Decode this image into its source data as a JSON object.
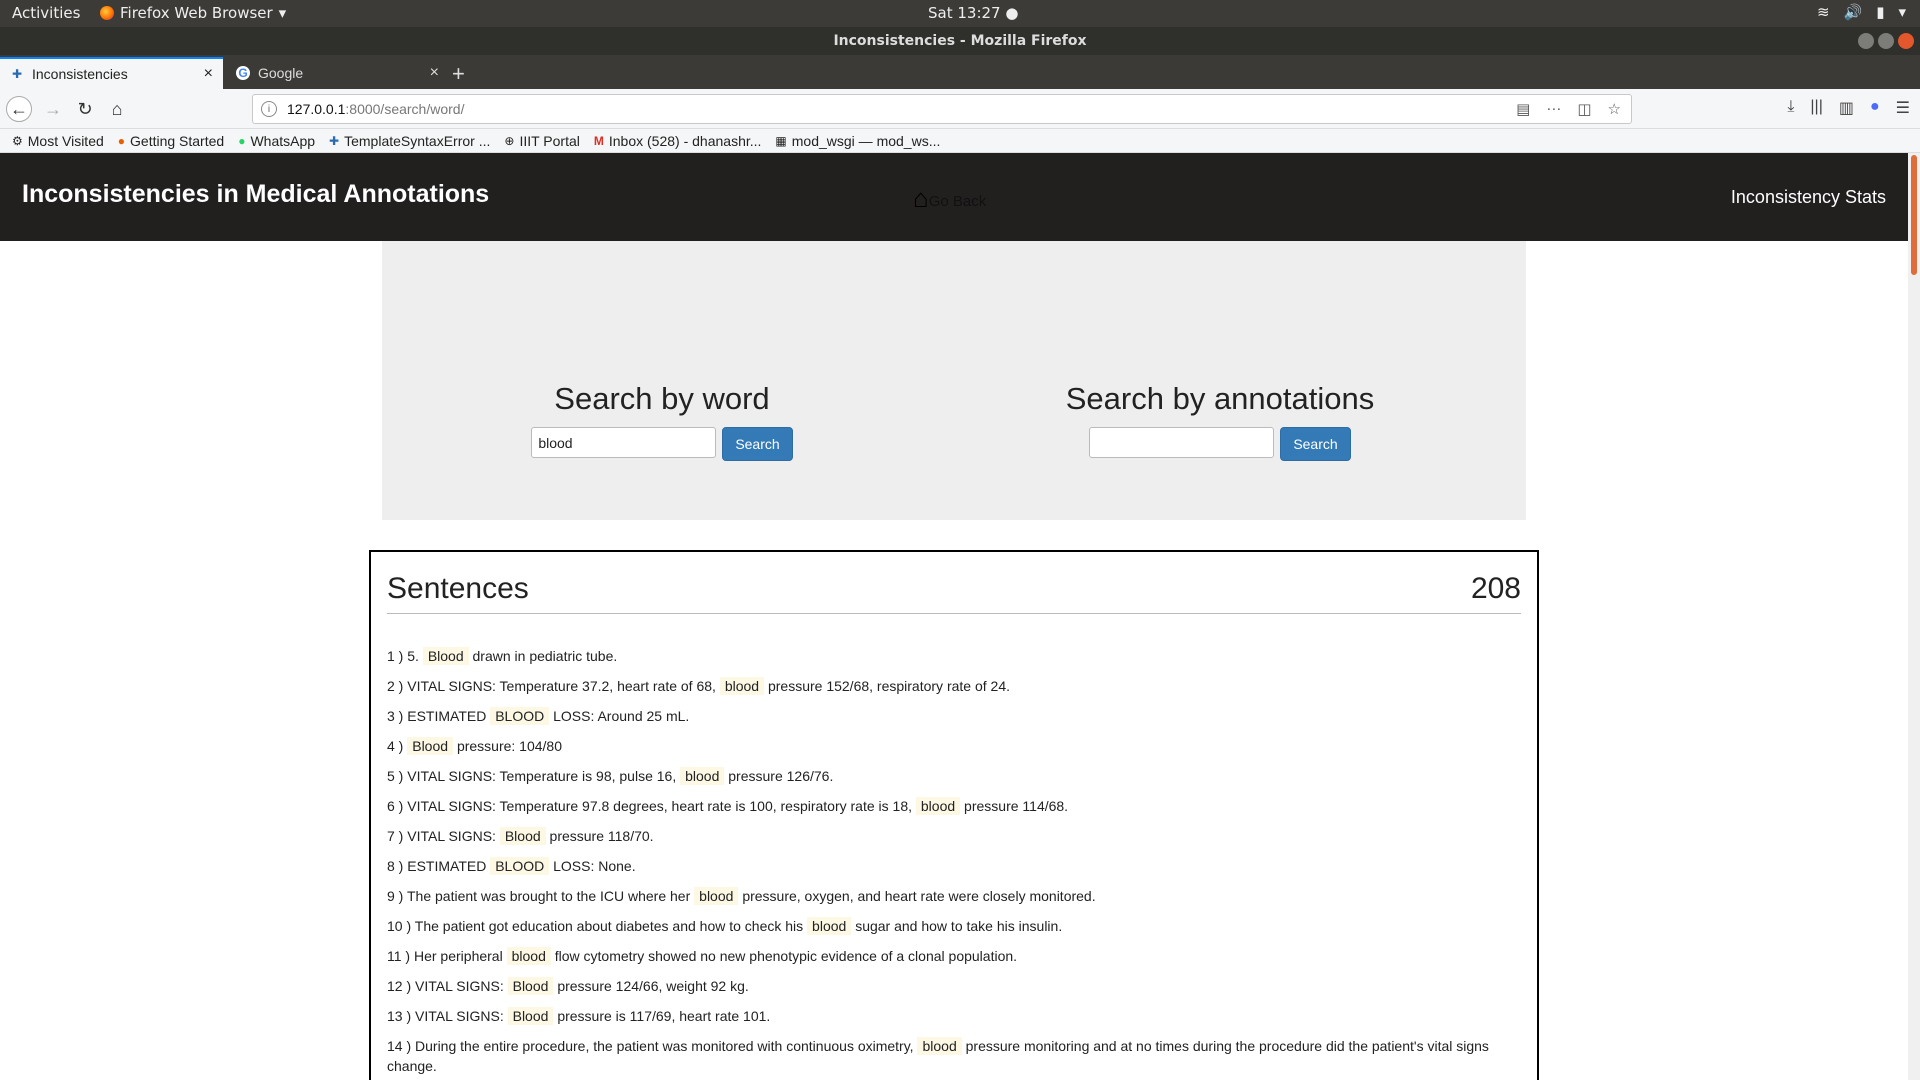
{
  "os": {
    "activities": "Activities",
    "app_menu": "Firefox Web Browser",
    "clock": "Sat 13:27 ●"
  },
  "window": {
    "title": "Inconsistencies - Mozilla Firefox"
  },
  "tabs": [
    {
      "label": "Inconsistencies",
      "active": true
    },
    {
      "label": "Google",
      "active": false
    }
  ],
  "url": {
    "host": "127.0.0.1",
    "path": ":8000/search/word/"
  },
  "bookmarks": [
    {
      "label": "Most Visited",
      "icon": "gear-icon"
    },
    {
      "label": "Getting Started",
      "icon": "firefox-icon"
    },
    {
      "label": "WhatsApp",
      "icon": "whatsapp-icon"
    },
    {
      "label": "TemplateSyntaxError ...",
      "icon": "django-icon"
    },
    {
      "label": "IIIT Portal",
      "icon": "globe-icon"
    },
    {
      "label": "Inbox (528) - dhanashr...",
      "icon": "gmail-icon"
    },
    {
      "label": "mod_wsgi — mod_ws...",
      "icon": "doc-icon"
    }
  ],
  "app": {
    "title": "Inconsistencies in Medical Annotations",
    "go_back": "Go Back",
    "stats_link": "Inconsistency Stats",
    "header_color": "#221f1f"
  },
  "search": {
    "word_heading": "Search by word",
    "word_value": "blood",
    "annot_heading": "Search by annotations",
    "annot_value": "",
    "button_label": "Search",
    "button_color": "#337ab7"
  },
  "sentences": {
    "title": "Sentences",
    "count": "208",
    "highlight_color": "#fcf8e3",
    "items": [
      {
        "num": "1 )",
        "pre": "5.",
        "hl": "Blood",
        "post": "drawn in pediatric tube."
      },
      {
        "num": "2 )",
        "pre": "VITAL SIGNS: Temperature 37.2, heart rate of 68,",
        "hl": "blood",
        "post": "pressure 152/68, respiratory rate of 24."
      },
      {
        "num": "3 )",
        "pre": "ESTIMATED",
        "hl": "BLOOD",
        "post": "LOSS: Around 25 mL."
      },
      {
        "num": "4 )",
        "pre": "",
        "hl": "Blood",
        "post": "pressure: 104/80"
      },
      {
        "num": "5 )",
        "pre": "VITAL SIGNS: Temperature is 98, pulse 16,",
        "hl": "blood",
        "post": "pressure 126/76."
      },
      {
        "num": "6 )",
        "pre": "VITAL SIGNS: Temperature 97.8 degrees, heart rate is 100, respiratory rate is 18,",
        "hl": "blood",
        "post": "pressure 114/68."
      },
      {
        "num": "7 )",
        "pre": "VITAL SIGNS:",
        "hl": "Blood",
        "post": "pressure 118/70."
      },
      {
        "num": "8 )",
        "pre": "ESTIMATED",
        "hl": "BLOOD",
        "post": "LOSS: None."
      },
      {
        "num": "9 )",
        "pre": "The patient was brought to the ICU where her",
        "hl": "blood",
        "post": "pressure, oxygen, and heart rate were closely monitored."
      },
      {
        "num": "10 )",
        "pre": "The patient got education about diabetes and how to check his",
        "hl": "blood",
        "post": "sugar and how to take his insulin."
      },
      {
        "num": "11 )",
        "pre": "Her peripheral",
        "hl": "blood",
        "post": "flow cytometry showed no new phenotypic evidence of a clonal population."
      },
      {
        "num": "12 )",
        "pre": "VITAL SIGNS:",
        "hl": "Blood",
        "post": "pressure 124/66, weight 92 kg."
      },
      {
        "num": "13 )",
        "pre": "VITAL SIGNS:",
        "hl": "Blood",
        "post": "pressure is 117/69, heart rate 101."
      },
      {
        "num": "14 )",
        "pre": "During the entire procedure, the patient was monitored with continuous oximetry,",
        "hl": "blood",
        "post": "pressure monitoring and at no times during the procedure did the patient's vital signs change."
      }
    ]
  }
}
